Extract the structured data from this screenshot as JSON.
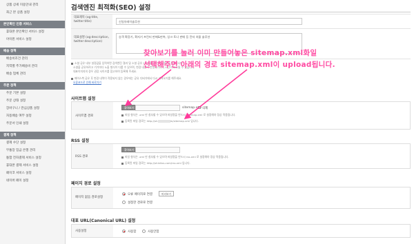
{
  "sidebar": {
    "top_items": [
      "상품 상세 이용안내 관리",
      "최근 본 상품 설정"
    ],
    "sections": [
      {
        "header": "본인확인 인증 서비스",
        "items": [
          "휴대폰 본인확인 서비스 설정",
          "아이핀 서비스 설정"
        ]
      },
      {
        "header": "배송 정책",
        "items": [
          "배송비조건 관리",
          "지역별 추가배송비 관리",
          "배송 업체 관리"
        ]
      },
      {
        "header": "주문 정책",
        "items": [
          "주문 기본 설정",
          "주문 상태 설정",
          "장바구니 / 관심상품 설정",
          "자동배송 여부 설정",
          "주문서 인쇄 설정"
        ]
      },
      {
        "header": "결제 정책",
        "items": [
          "결제 수단 설정",
          "무통장 입금 은행 관리",
          "통합 전자결제 서비스 설정",
          "휴대폰 결제 서비스 설정",
          "페이코 서비스 설정",
          "네이버 페이 설정"
        ]
      }
    ]
  },
  "page": {
    "title": "검색엔진 최적화(SEO) 설정"
  },
  "og": {
    "title_label": "대표제목 (og:title, twitter:title)",
    "title_value": "신일유레이솔루션",
    "desc_label": "대표설명 (og:description, twitter:description)",
    "desc_value": "승객 확장기, 확지기 프린터 판매&판촉, 잉크 토너 판매 등 전자 처물 솔루션",
    "notes": [
      "소셜 공유 내부 설정값을 입력하면 검색엔진 결과 및 소셜 공유 시 노출되는 대표 정보가 설정됩니다.",
      "소셜을 공유하려고 기기마다 노출 형식이 다를 수 있으며, 변경 내용이 반영되기까지 시간이 소요될 수 있습니다.",
      "대표이미지의 경우 권장 사이즈를 참고하여 등록해 주세요."
    ],
    "notes2": "페이스북 공유 후 변경 내역이 적용되지 않는 경우에는 공유 디버거에서 다시 가져오기를 해주세요.",
    "debugger_link": "오류코드로 인해 바로가기"
  },
  "annotation": {
    "line1": "찾아보기를 눌러 이미 만들어놓은 sitemap.xml화일",
    "line2": "선택해주면 아래의 경로 sitemap.xml이 upload됩니다."
  },
  "sitemap": {
    "section_title": "사이트맵 설정",
    "label": "사이트맵 경로",
    "browse_button": "찾아보기",
    "file_name": "sitemap.xml",
    "delete_label": "삭제",
    "note1": "파일 형식은 .xml 만 첨부할 수 있으며 파일명을 반드시 sitemap.xml 로 설정해야 정상 적용됩니다.",
    "note2_prefix": "등록된 파일 경로는 http://sh",
    "note2_suffix": "m/sitemap.xml 입니다."
  },
  "rss": {
    "section_title": "RSS 설정",
    "label": "RSS 경로",
    "browse_button": "찾아보기",
    "note1": "파일 형식은 .xml 만 첨부할 수 있으며 파일명을 반드시 rss.xml 로 설정해야 정상 적용됩니다.",
    "note2": "등록된 파일 경로는 http://shinilos.com/rss.xml 입니다."
  },
  "error_page": {
    "section_title": "페이지 경로 설정",
    "label": "페이지 없음 경로설정",
    "option1": "오류 페이지로 연결",
    "preview_button": "미리보기",
    "option2": "설정한 경로로 연결"
  },
  "canonical": {
    "section_title": "대표 URL(Canonical URL) 설정",
    "label": "사용설정",
    "use": "사용함",
    "no_use": "사용안함"
  },
  "colors": {
    "annotation": "#ff4aa2",
    "arrow": "#ff3a9a",
    "sidebar_header": "#7b8087"
  }
}
